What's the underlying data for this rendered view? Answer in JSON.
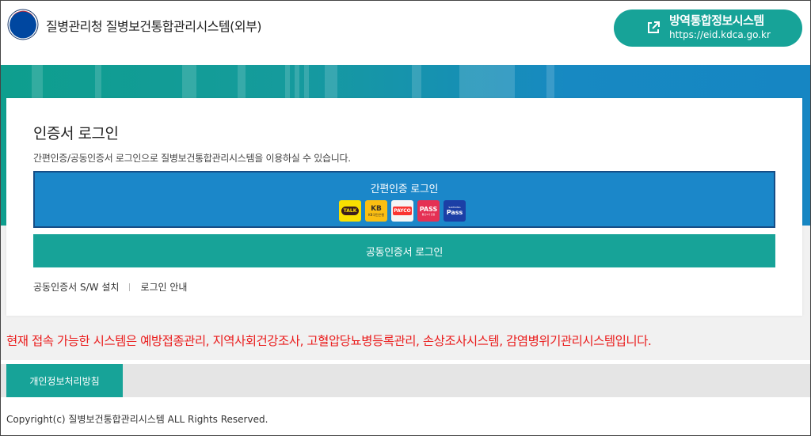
{
  "header": {
    "site_title": "질병관리청 질병보건통합관리시스템(외부)",
    "eid_title": "방역통합정보시스템",
    "eid_url": "https://eid.kdca.go.kr"
  },
  "login": {
    "title": "인증서 로그인",
    "description": "간편인증/공동인증서 로그인으로 질병보건통합관리시스템을 이용하실 수 있습니다.",
    "simple_label": "간편인증 로그인",
    "providers": {
      "kakao": "TALK",
      "kb": "KB",
      "kb_sub": "KB국민은행",
      "payco": "PAYCO",
      "pass": "PASS",
      "pass_sub": "통신3사 인증",
      "samsung_top": "SAMSUNG",
      "samsung": "Pass"
    },
    "joint_label": "공동인증서 로그인",
    "links": {
      "install": "공동인증서 S/W 설치",
      "guide": "로그인 안내"
    }
  },
  "notice": "현재 접속 가능한 시스템은 예방접종관리, 지역사회건강조사, 고혈압당뇨병등록관리, 손상조사시스템, 감염병위기관리시스템입니다.",
  "footer": {
    "privacy": "개인정보처리방침",
    "copyright": "Copyright(c) 질병보건통합관리시스템 ALL Rights Reserved."
  },
  "colors": {
    "teal": "#17a398",
    "blue": "#1b87c9",
    "notice_red": "#ea1c1c"
  },
  "icons": [
    "kdca-logo-icon",
    "external-link-icon"
  ]
}
